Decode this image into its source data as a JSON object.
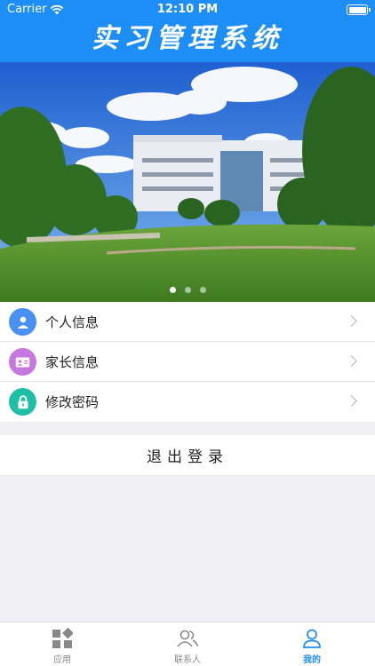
{
  "status_bar": {
    "carrier": "Carrier",
    "time": "12:10 PM"
  },
  "header": {
    "title": "实习管理系统"
  },
  "banner": {
    "slides": 3,
    "active_slide": 1
  },
  "menu": {
    "items": [
      {
        "label": "个人信息",
        "icon": "person-icon",
        "color": "#4a90f2"
      },
      {
        "label": "家长信息",
        "icon": "id-card-icon",
        "color": "#c777e0"
      },
      {
        "label": "修改密码",
        "icon": "lock-icon",
        "color": "#1fbfa7"
      }
    ]
  },
  "logout": {
    "label": "退出登录"
  },
  "tabbar": {
    "tabs": [
      {
        "label": "应用",
        "icon": "apps-icon",
        "active": false
      },
      {
        "label": "联系人",
        "icon": "contacts-icon",
        "active": false
      },
      {
        "label": "我的",
        "icon": "profile-icon",
        "active": true
      }
    ]
  },
  "colors": {
    "accent": "#1c8ef5",
    "background": "#f0f0f4"
  }
}
